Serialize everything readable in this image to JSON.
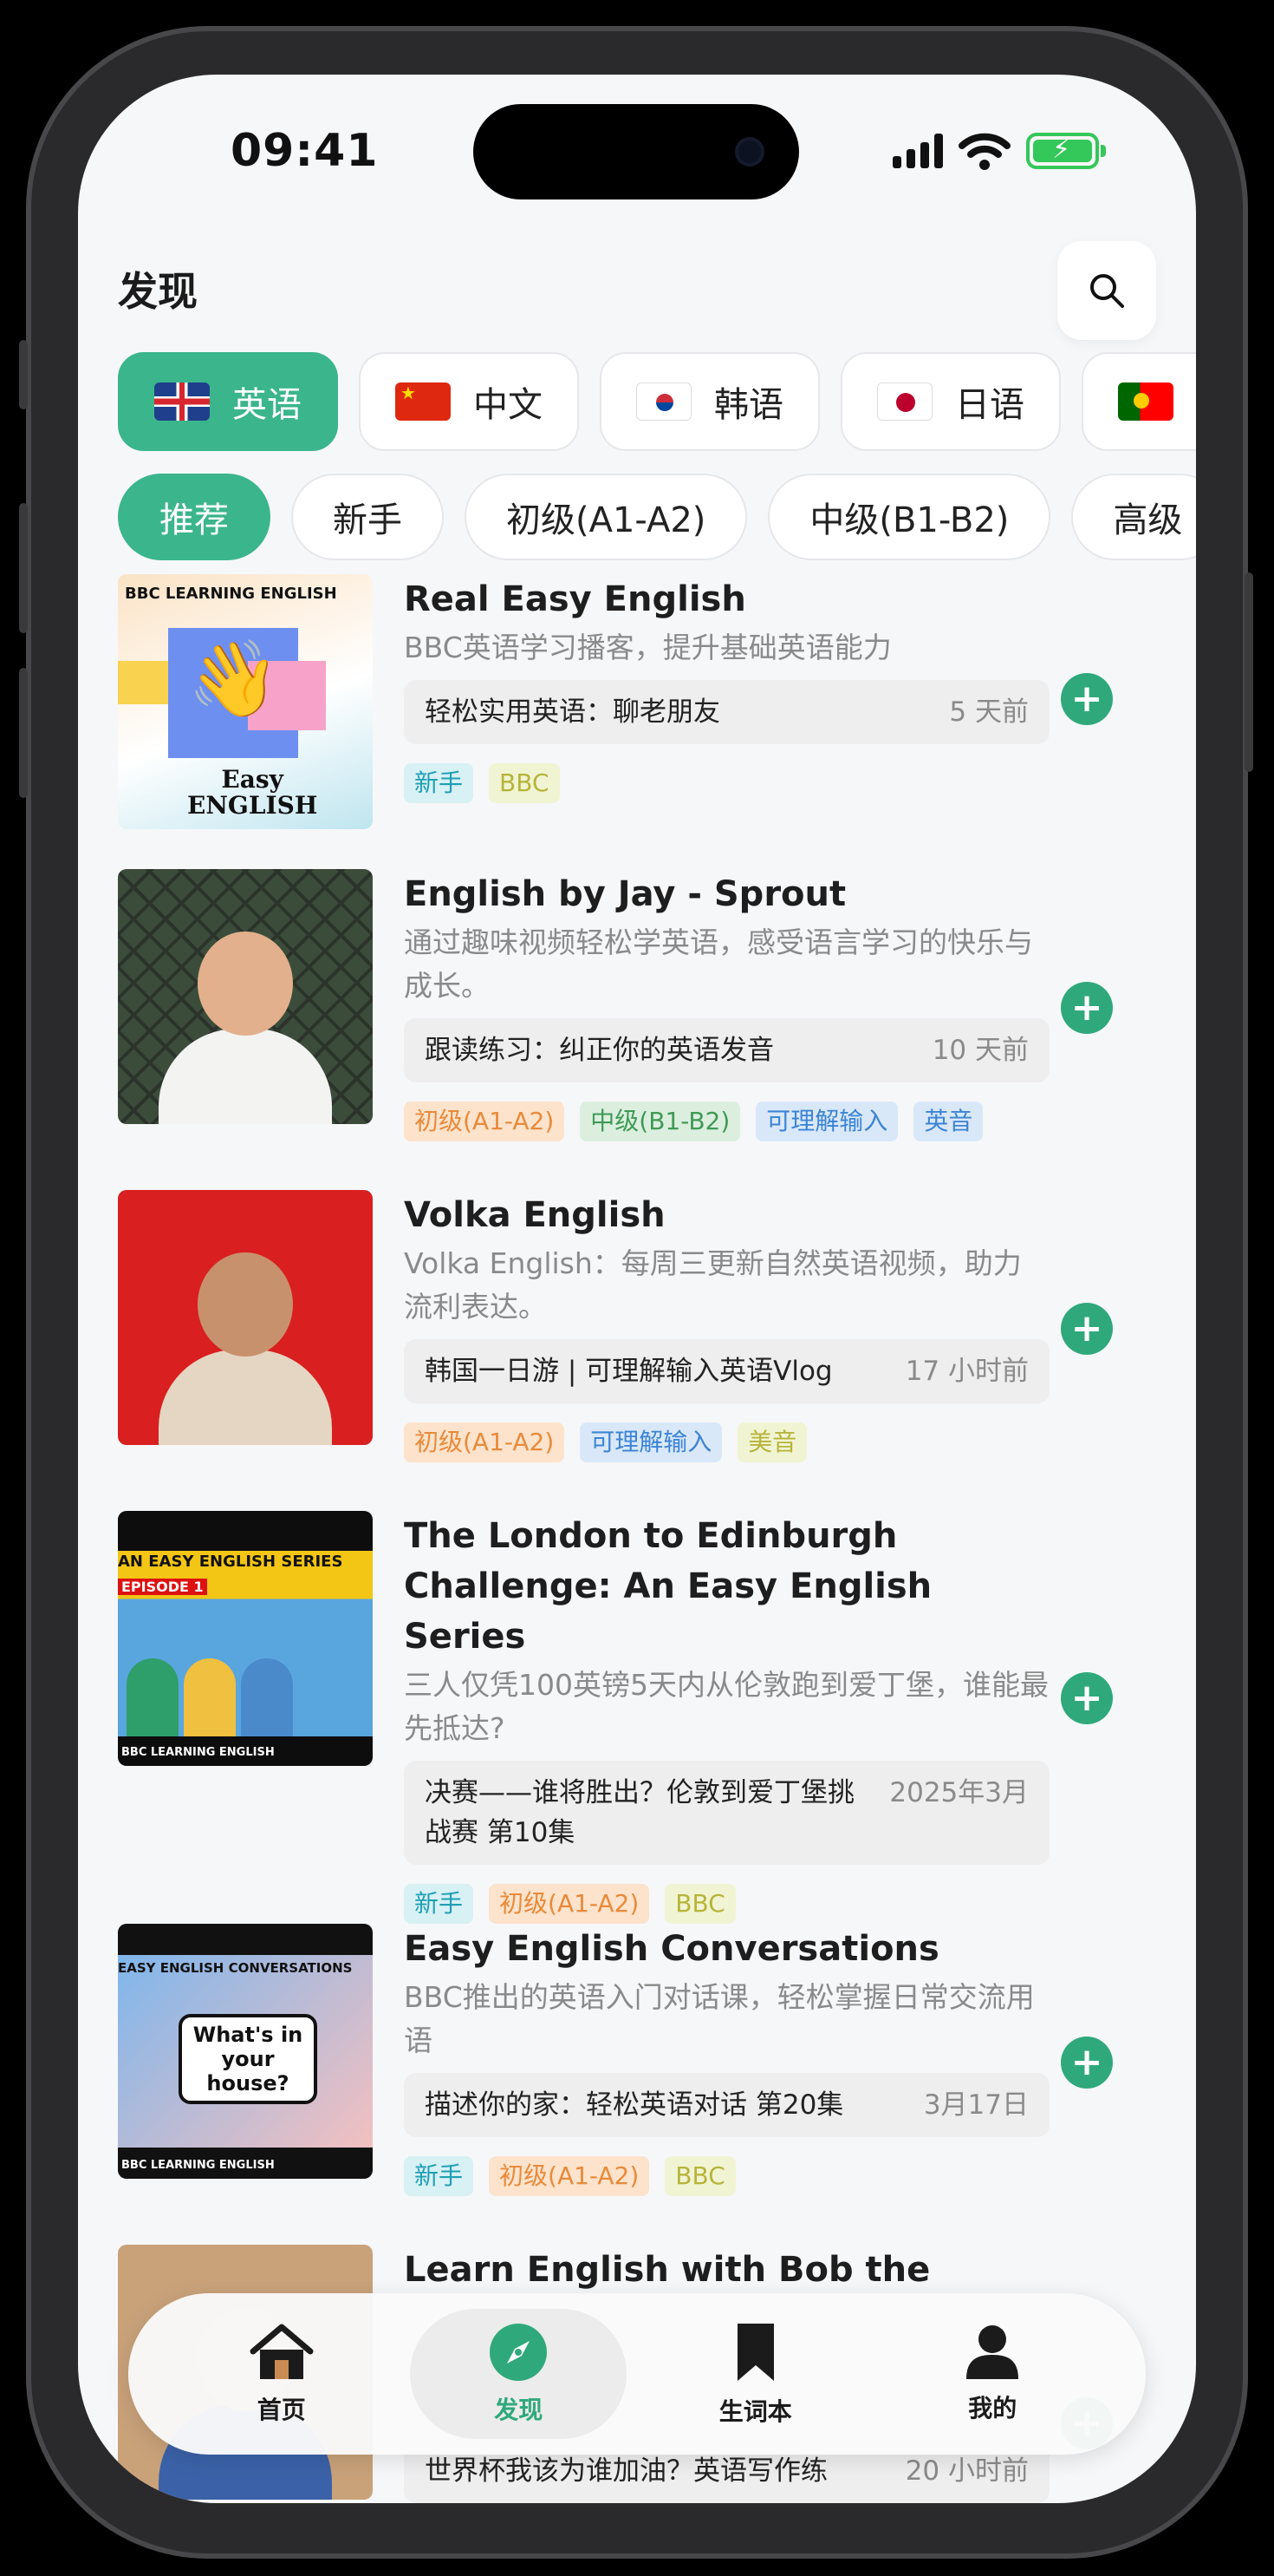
{
  "status": {
    "time": "09:41"
  },
  "header": {
    "title": "发现"
  },
  "languages": [
    {
      "label": "英语",
      "flag": "uk-flag-icon",
      "active": true
    },
    {
      "label": "中文",
      "flag": "china-flag-icon",
      "active": false
    },
    {
      "label": "韩语",
      "flag": "korea-flag-icon",
      "active": false
    },
    {
      "label": "日语",
      "flag": "japan-flag-icon",
      "active": false
    },
    {
      "label": "",
      "flag": "portugal-flag-icon",
      "active": false
    }
  ],
  "levels": [
    {
      "label": "推荐",
      "active": true
    },
    {
      "label": "新手",
      "active": false
    },
    {
      "label": "初级(A1-A2)",
      "active": false
    },
    {
      "label": "中级(B1-B2)",
      "active": false
    },
    {
      "label": "高级",
      "active": false
    }
  ],
  "items": [
    {
      "title": "Real Easy English",
      "description": "BBC英语学习播客，提升基础英语能力",
      "episode": "轻松实用英语：聊老朋友",
      "episode_time": "5 天前",
      "tags": [
        "新手",
        "BBC"
      ],
      "thumb": {
        "header": "BBC LEARNING ENGLISH",
        "label_line1": "Easy",
        "label_line2": "ENGLISH"
      }
    },
    {
      "title": "English by Jay - Sprout",
      "description": "通过趣味视频轻松学英语，感受语言学习的快乐与成长。",
      "episode": "跟读练习：纠正你的英语发音",
      "episode_time": "10 天前",
      "tags": [
        "初级(A1-A2)",
        "中级(B1-B2)",
        "可理解输入",
        "英音"
      ]
    },
    {
      "title": "Volka English",
      "description": "Volka English：每周三更新自然英语视频，助力流利表达。",
      "episode": "韩国一日游 | 可理解输入英语Vlog",
      "episode_time": "17 小时前",
      "tags": [
        "初级(A1-A2)",
        "可理解输入",
        "美音"
      ]
    },
    {
      "title": "The London to Edinburgh Challenge: An Easy English Series",
      "description": "三人仅凭100英镑5天内从伦敦跑到爱丁堡，谁能最先抵达?",
      "episode": "决赛——谁将胜出？伦敦到爱丁堡挑战赛 第10集",
      "episode_time": "2025年3月",
      "tags": [
        "新手",
        "初级(A1-A2)",
        "BBC"
      ],
      "thumb": {
        "series": "AN EASY ENGLISH SERIES",
        "episode": "EPISODE 1",
        "footer": "BBC LEARNING ENGLISH"
      }
    },
    {
      "title": "Easy English Conversations",
      "description": "BBC推出的英语入门对话课，轻松掌握日常交流用语",
      "episode": "描述你的家：轻松英语对话 第20集",
      "episode_time": "3月17日",
      "tags": [
        "新手",
        "初级(A1-A2)",
        "BBC"
      ],
      "thumb": {
        "series": "EASY ENGLISH CONVERSATIONS",
        "bubble": "What's in your house?",
        "footer": "BBC LEARNING ENGLISH"
      }
    },
    {
      "title": "Learn English with Bob the",
      "episode": "世界杯我该为谁加油？英语写作练",
      "episode_time": "20 小时前"
    }
  ],
  "tabbar": [
    {
      "label": "首页",
      "icon": "home-icon"
    },
    {
      "label": "发现",
      "icon": "compass-icon",
      "active": true
    },
    {
      "label": "生词本",
      "icon": "bookmark-icon"
    },
    {
      "label": "我的",
      "icon": "person-icon"
    }
  ],
  "colors": {
    "accent": "#3bb58c",
    "add_button": "#2fa97b"
  }
}
